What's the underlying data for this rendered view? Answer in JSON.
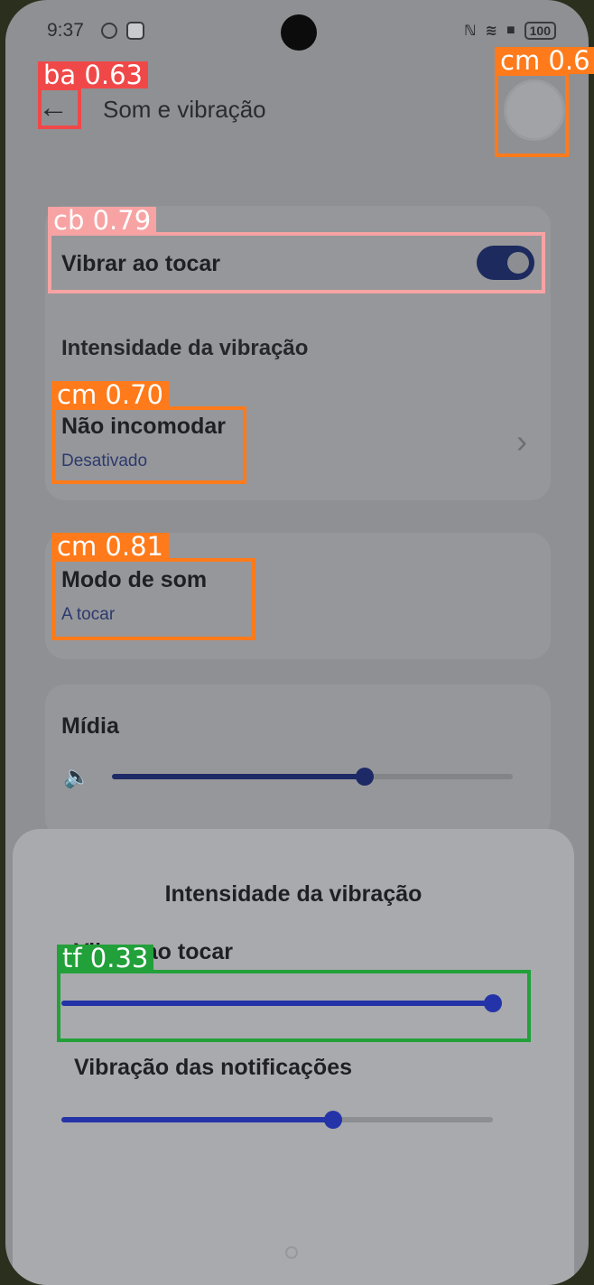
{
  "status_bar": {
    "time": "9:37",
    "battery": "100"
  },
  "header": {
    "title": "Som e vibração",
    "back_icon": "arrow-left-icon"
  },
  "settings": {
    "vibrate_on_touch": {
      "label": "Vibrar ao tocar",
      "enabled": true
    },
    "vibration_intensity_label": "Intensidade da vibração",
    "do_not_disturb": {
      "label": "Não incomodar",
      "value": "Desativado"
    },
    "sound_mode": {
      "label": "Modo de som",
      "value": "A tocar"
    },
    "media": {
      "label": "Mídia",
      "level": 0.63
    }
  },
  "sheet": {
    "title": "Intensidade da vibração",
    "touch_vibration": {
      "label": "Vibrar ao tocar",
      "level": 1.0
    },
    "notification_vibration": {
      "label": "Vibração das notificações",
      "level": 0.63
    }
  },
  "detections": [
    {
      "label": "ba 0.63",
      "color": "#f04848"
    },
    {
      "label": "cm 0.6",
      "color": "#ff7a1a"
    },
    {
      "label": "cb 0.79",
      "color": "#f7a3a3"
    },
    {
      "label": "cm 0.70",
      "color": "#ff7a1a"
    },
    {
      "label": "cm 0.81",
      "color": "#ff7a1a"
    },
    {
      "label": "tf 0.33",
      "color": "#22a03a"
    }
  ],
  "colors": {
    "accent": "#1e2a66",
    "sheet_accent": "#2434a8"
  }
}
